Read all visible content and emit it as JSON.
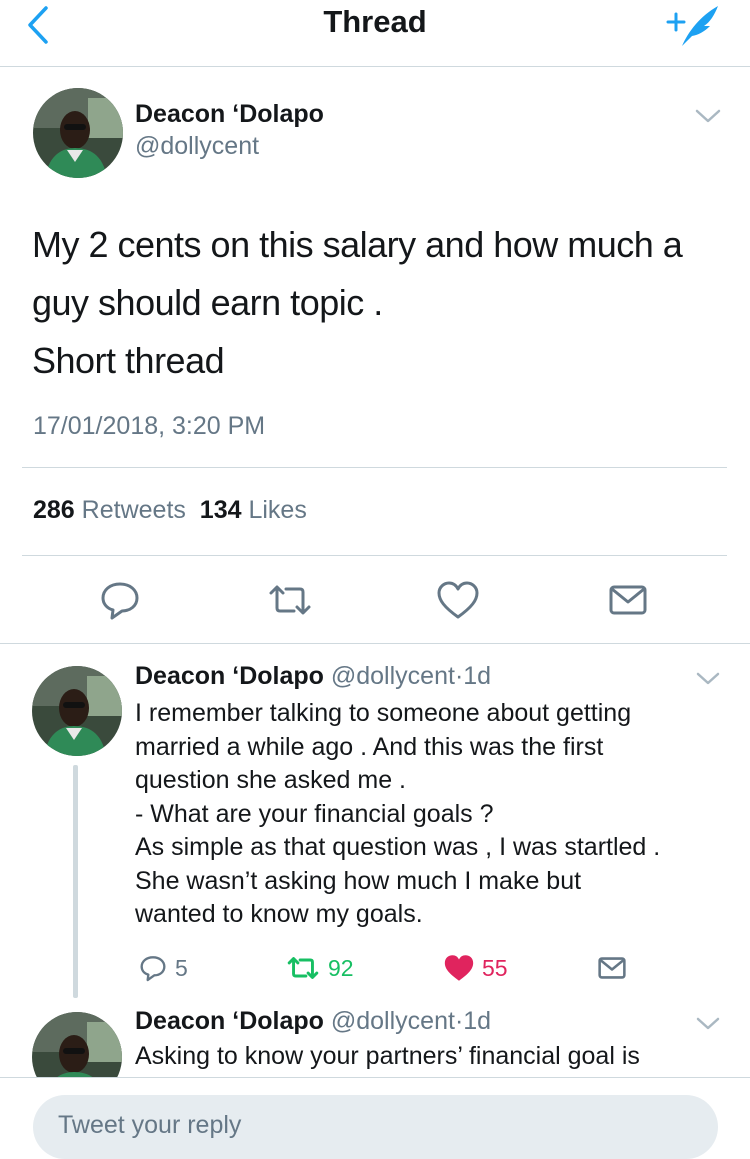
{
  "nav": {
    "title": "Thread",
    "back_icon": "chevron-left-icon",
    "compose_icon": "compose-tweet-icon",
    "accent": "#1da1f2"
  },
  "main_tweet": {
    "name": "Deacon ‘Dolapo",
    "handle": "@dollycent",
    "lines": [
      "My 2 cents on this salary and how much a",
      "guy should earn topic .",
      "Short thread"
    ],
    "timestamp": "17/01/2018, 3:20 PM",
    "retweets_count": "286",
    "retweets_label": "Retweets",
    "likes_count": "134",
    "likes_label": "Likes",
    "actions": [
      "reply-icon",
      "retweet-icon",
      "like-icon",
      "message-icon"
    ]
  },
  "replies": [
    {
      "name": "Deacon ‘Dolapo",
      "handle": "@dollycent",
      "separator": "·",
      "age": "1d",
      "lines": [
        "I remember talking to someone about getting",
        "married a while ago . And this was the first",
        "question she asked me .",
        "- What are your financial goals ?",
        "As simple as that question was , I was startled .",
        "She wasn’t asking how much I make but",
        "wanted to know my goals."
      ],
      "reply_count": "5",
      "retweet_count": "92",
      "like_count": "55",
      "like_color": "#e0245e",
      "retweet_color": "#17bf63"
    },
    {
      "name": "Deacon ‘Dolapo",
      "handle": "@dollycent",
      "separator": "·",
      "age": "1d",
      "lines": [
        "Asking to know your partners’ financial goal is"
      ]
    }
  ],
  "reply_bar": {
    "placeholder": "Tweet your reply"
  }
}
